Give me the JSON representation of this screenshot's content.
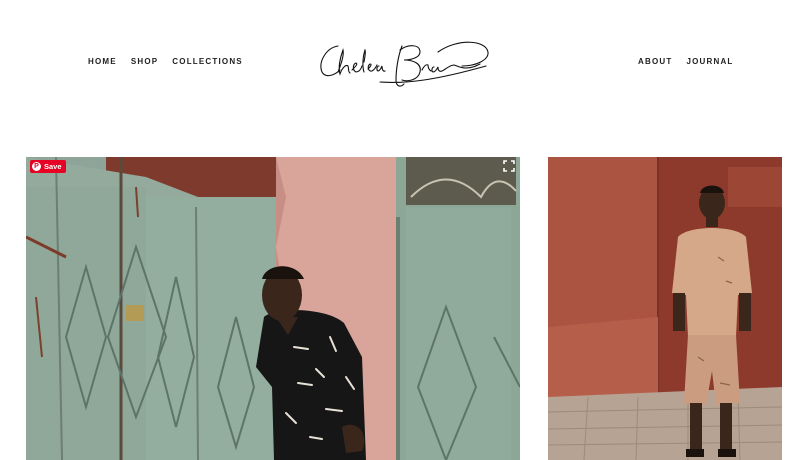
{
  "nav_left": [
    "HOME",
    "SHOP",
    "COLLECTIONS"
  ],
  "nav_right": [
    "ABOUT",
    "JOURNAL"
  ],
  "logo": {
    "text": "Chelsea Bravo",
    "icon": "signature-logo"
  },
  "gallery": {
    "save_label": "Save",
    "save_icon": "pinterest-icon",
    "expand_icon": "expand-icon",
    "pinterest_color": "#e60023"
  }
}
